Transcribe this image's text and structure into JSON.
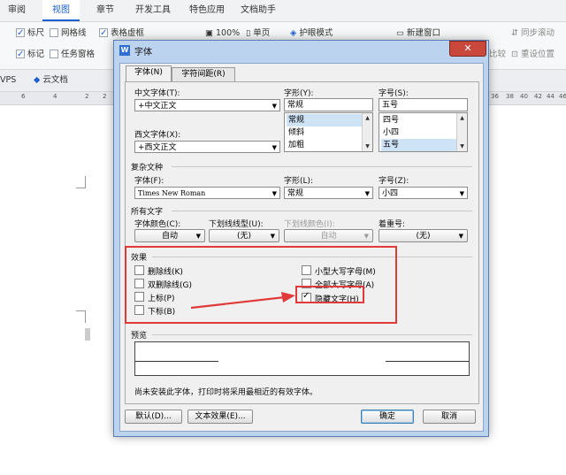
{
  "app": {
    "menu_tabs": [
      "审阅",
      "视图",
      "章节",
      "开发工具",
      "特色应用",
      "文档助手"
    ],
    "active_menu": "视图",
    "toolbar": {
      "ruler": "标尺",
      "gridlines": "网格线",
      "table_gridlines": "表格虚框",
      "zoom": "100%",
      "single_page": "单页",
      "eye_mode": "护眼模式",
      "new_window": "新建窗口",
      "sync_scroll": "同步滚动",
      "marks": "标记",
      "task_pane": "任务窗格",
      "compare": "比较",
      "reset_position": "重设位置"
    },
    "tabstrip": {
      "wps": "VPS",
      "cloud_docs": "云文档"
    },
    "ruler_numbers": [
      "6",
      "4",
      "2",
      "2",
      "36",
      "38",
      "40",
      "42",
      "44",
      "46"
    ]
  },
  "dialog": {
    "title": "字体",
    "close_symbol": "✕",
    "tabs": [
      "字体(N)",
      "字符间距(R)"
    ],
    "chinese_font": {
      "label": "中文字体(T):",
      "value": "+中文正文"
    },
    "western_font": {
      "label": "西文字体(X):",
      "value": "+西文正文"
    },
    "style": {
      "label": "字形(Y):",
      "value": "常规",
      "options": [
        "常规",
        "倾斜",
        "加粗"
      ],
      "selected": "常规"
    },
    "size": {
      "label": "字号(S):",
      "value": "五号",
      "options": [
        "四号",
        "小四",
        "五号"
      ],
      "selected": "五号"
    },
    "complex_section": "复杂文种",
    "complex_font": {
      "label": "字体(F):",
      "value": "Times New Roman"
    },
    "complex_style": {
      "label": "字形(L):",
      "value": "常规"
    },
    "complex_size": {
      "label": "字号(Z):",
      "value": "小四"
    },
    "all_text_section": "所有文字",
    "font_color": {
      "label": "字体颜色(C):",
      "value": "自动"
    },
    "underline_type": {
      "label": "下划线线型(U):",
      "value": "(无)"
    },
    "underline_color": {
      "label": "下划线颜色(I):",
      "value": "自动"
    },
    "emphasis": {
      "label": "着重号:",
      "value": "(无)"
    },
    "effects_section": "效果",
    "effects": {
      "strikethrough": {
        "label": "删除线(K)",
        "checked": false
      },
      "double_strikethrough": {
        "label": "双删除线(G)",
        "checked": false
      },
      "superscript": {
        "label": "上标(P)",
        "checked": false
      },
      "subscript": {
        "label": "下标(B)",
        "checked": false
      },
      "small_caps": {
        "label": "小型大写字母(M)",
        "checked": false
      },
      "all_caps": {
        "label": "全部大写字母(A)",
        "checked": false
      },
      "hidden": {
        "label": "隐藏文字(H)",
        "checked": true
      }
    },
    "preview_section": "预览",
    "preview_note": "尚未安装此字体，打印时将采用最相近的有效字体。",
    "buttons": {
      "default": "默认(D)...",
      "text_effects": "文本效果(E)...",
      "ok": "确定",
      "cancel": "取消"
    }
  },
  "colors": {
    "annotation_red": "#e03a3a",
    "accent_blue": "#1b5fd1"
  }
}
